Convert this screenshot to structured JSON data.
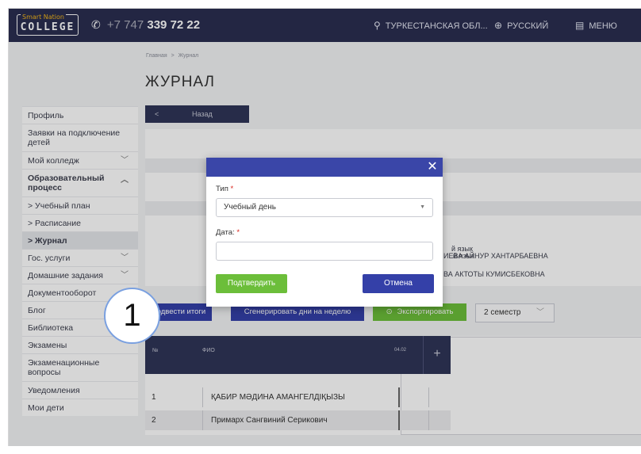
{
  "header": {
    "logo_small": "Smart Nation",
    "logo_text": "COLLEGE",
    "phone_prefix": "+7 747",
    "phone_main": "339 72 22",
    "region": "ТУРКЕСТАНСКАЯ ОБЛ...",
    "language": "РУССКИЙ",
    "menu": "МЕНЮ"
  },
  "breadcrumb": {
    "home": "Главная",
    "separator": ">",
    "current": "Журнал"
  },
  "page_title": "ЖУРНАЛ",
  "back_button": {
    "arrow": "<",
    "label": "Назад"
  },
  "sidebar": {
    "items": [
      {
        "label": "Профиль"
      },
      {
        "label": "Заявки на подключение детей"
      },
      {
        "label": "Мой колледж",
        "chevron": "﹀"
      },
      {
        "label": "Образовательный процесс",
        "chevron": "︿"
      },
      {
        "label": "> Учебный план"
      },
      {
        "label": "> Расписание"
      },
      {
        "label": "> Журнал"
      },
      {
        "label": "Гос. услуги",
        "chevron": "﹀"
      },
      {
        "label": "Домашние задания",
        "chevron": "﹀"
      },
      {
        "label": "Документооборот"
      },
      {
        "label": "Блог"
      },
      {
        "label": "Библиотека"
      },
      {
        "label": "Экзамены"
      },
      {
        "label": "Экзаменационные вопросы"
      },
      {
        "label": "Уведомления"
      },
      {
        "label": "Мои дети"
      }
    ]
  },
  "info": {
    "subject": "й язык",
    "teacher_1": "ИЕВА АЙНУР ХАНТАРБАЕВНА",
    "teacher_2": "ВА АКТОТЫ КУМИСБЕКОВНА"
  },
  "actions": {
    "summarize": "Подвести итоги",
    "generate": "Сгенерировать дни на неделю",
    "export": "Экспортировать",
    "semester": "2 семестр",
    "semester_chevron": "﹀"
  },
  "table": {
    "col_num": "№",
    "col_name": "ФИО",
    "date": "04.02",
    "add": "+",
    "rows": [
      {
        "num": "1",
        "name": "ҚАБИР МӘДИНА АМАНГЕЛДІҚЫЗЫ"
      },
      {
        "num": "2",
        "name": "Примарх Сангвиний Серикович"
      }
    ]
  },
  "modal": {
    "close": "✕",
    "type_label": "Тип",
    "type_value": "Учебный день",
    "type_arrow": "▼",
    "date_label": "Дата:",
    "required_mark": "*",
    "date_value": "",
    "confirm": "Подтвердить",
    "cancel": "Отмена"
  },
  "callout": "1",
  "colors": {
    "header_bg": "#2a2e50",
    "modal_header": "#3a46a8",
    "confirm_green": "#6cbe3a",
    "cancel_blue": "#3440a8",
    "required_red": "#d9241b"
  }
}
